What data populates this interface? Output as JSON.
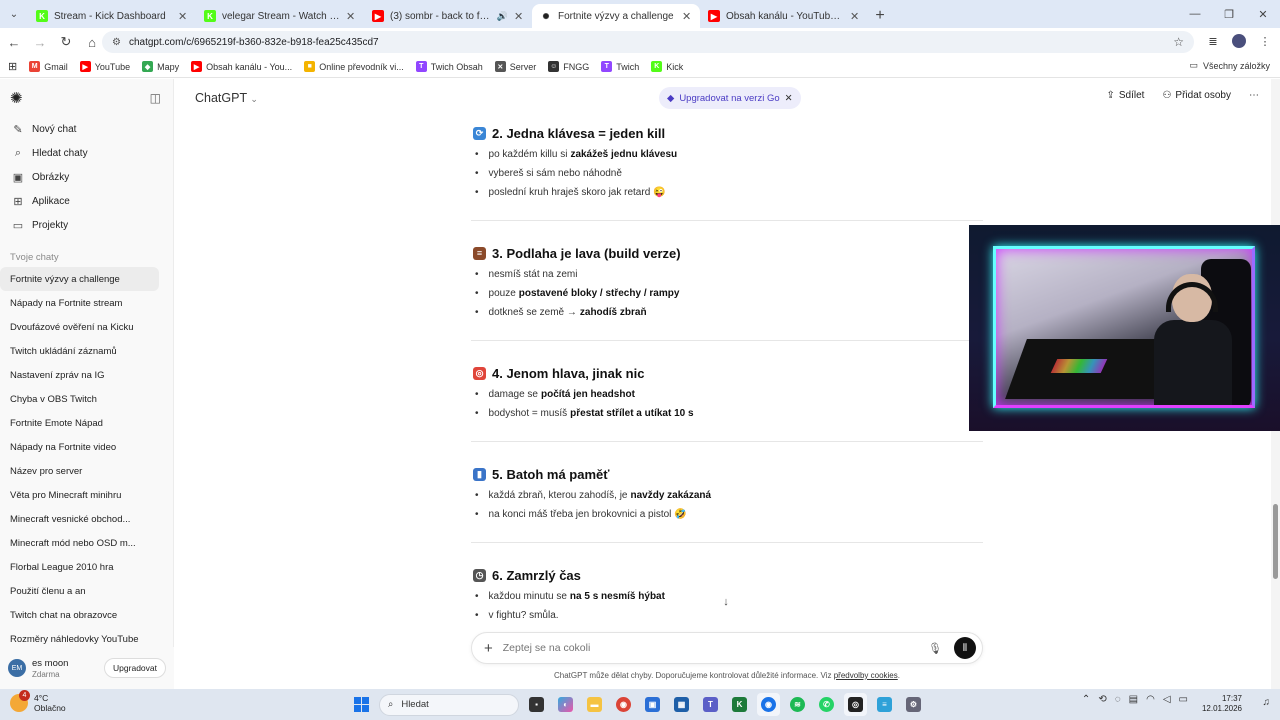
{
  "browser": {
    "tabs": [
      {
        "title": "Stream - Kick Dashboard",
        "favicon": "kick",
        "color": "#53fc18",
        "active": false
      },
      {
        "title": "velegar Stream - Watch Live on",
        "favicon": "kick",
        "color": "#53fc18",
        "active": false
      },
      {
        "title": "(3) sombr - back to friends",
        "favicon": "youtube",
        "color": "#ff0000",
        "active": false,
        "audio": true
      },
      {
        "title": "Fortnite výzvy a challenge",
        "favicon": "chatgpt",
        "color": "#222222",
        "active": true
      },
      {
        "title": "Obsah kanálu - YouTube Studio",
        "favicon": "youtube",
        "color": "#ff0000",
        "active": false
      }
    ],
    "url": "chatgpt.com/c/6965219f-b360-832e-b918-fea25c435cd7",
    "bookmarks": [
      {
        "label": "Gmail",
        "color": "#ea4335",
        "glyph": "M"
      },
      {
        "label": "YouTube",
        "color": "#ff0000",
        "glyph": "▶"
      },
      {
        "label": "Mapy",
        "color": "#34a853",
        "glyph": "◆"
      },
      {
        "label": "Obsah kanálu - You...",
        "color": "#ff0000",
        "glyph": "▶"
      },
      {
        "label": "Online převodník vi...",
        "color": "#f4b400",
        "glyph": "■"
      },
      {
        "label": "Twich Obsah",
        "color": "#9146ff",
        "glyph": "T"
      },
      {
        "label": "Server",
        "color": "#555555",
        "glyph": "✕"
      },
      {
        "label": "FNGG",
        "color": "#333333",
        "glyph": "☺"
      },
      {
        "label": "Twich",
        "color": "#9146ff",
        "glyph": "T"
      },
      {
        "label": "Kick",
        "color": "#53fc18",
        "glyph": "K"
      }
    ],
    "all_bookmarks": "Všechny záložky"
  },
  "sidebar": {
    "nav": [
      {
        "label": "Nový chat",
        "icon": "edit-icon",
        "glyph": "✎"
      },
      {
        "label": "Hledat chaty",
        "icon": "search-icon",
        "glyph": "⌕"
      },
      {
        "label": "Obrázky",
        "icon": "image-icon",
        "glyph": "▣"
      },
      {
        "label": "Aplikace",
        "icon": "apps-icon",
        "glyph": "⊞"
      },
      {
        "label": "Projekty",
        "icon": "folder-icon",
        "glyph": "▭"
      }
    ],
    "section_label": "Tvoje chaty",
    "chats": [
      "Fortnite výzvy a challenge",
      "Nápady na Fortnite stream",
      "Dvoufázové ověření na Kicku",
      "Twitch ukládání záznamů",
      "Nastavení zpráv na IG",
      "Chyba v OBS Twitch",
      "Fortnite Emote Nápad",
      "Nápady na Fortnite video",
      "Název pro server",
      "Věta pro Minecraft minihru",
      "Minecraft vesnické obchod...",
      "Minecraft mód nebo OSD m...",
      "Florbal League 2010 hra",
      "Použití členu a an",
      "Twitch chat na obrazovce",
      "Rozměry náhledovky YouTube"
    ],
    "user": {
      "initials": "EM",
      "name": "es moon",
      "plan": "Zdarma",
      "upgrade": "Upgradovat"
    }
  },
  "header": {
    "model": "ChatGPT",
    "upgrade_pill": "Upgradovat na verzi Go",
    "share": "Sdílet",
    "add_people": "Přidat osoby"
  },
  "sections": [
    {
      "title": "2. Jedna klávesa = jeden kill",
      "emoji_color": "#3a86d6",
      "emoji_glyph": "⟳",
      "items": [
        {
          "text": "po každém killu si",
          "bold": "zakážeš jednu klávesu"
        },
        {
          "text": "vybereš si sám nebo náhodně",
          "bold": ""
        },
        {
          "text": "poslední kruh hraješ skoro jak retard 😜",
          "bold": ""
        }
      ]
    },
    {
      "title": "3. Podlaha je lava (build verze)",
      "emoji_color": "#8b4a2a",
      "emoji_glyph": "≡",
      "items": [
        {
          "text": "nesmíš stát na zemi",
          "bold": ""
        },
        {
          "text": "pouze",
          "bold": "postavené bloky / střechy / rampy"
        },
        {
          "text": "dotkneš se země →",
          "bold": "zahodíš zbraň"
        }
      ]
    },
    {
      "title": "4. Jenom hlava, jinak nic",
      "emoji_color": "#e0453a",
      "emoji_glyph": "◎",
      "items": [
        {
          "text": "damage se",
          "bold": "počítá jen headshot"
        },
        {
          "text": "bodyshot = musíš",
          "bold": "přestat střílet a utíkat 10 s"
        }
      ]
    },
    {
      "title": "5. Batoh má paměť",
      "emoji_color": "#3a74c8",
      "emoji_glyph": "▮",
      "items": [
        {
          "text": "každá zbraň, kterou zahodíš, je",
          "bold": "navždy zakázaná"
        },
        {
          "text": "na konci máš třeba jen brokovnici a pistol 🤣",
          "bold": ""
        }
      ]
    },
    {
      "title": "6. Zamrzlý čas",
      "emoji_color": "#555555",
      "emoji_glyph": "◷",
      "items": [
        {
          "text": "každou minutu se",
          "bold": "na 5 s nesmíš hýbat"
        },
        {
          "text": "v fightu? smůla.",
          "bold": ""
        }
      ]
    }
  ],
  "composer": {
    "placeholder": "Zeptej se na cokoli"
  },
  "disclaimer": {
    "text": "ChatGPT může dělat chyby. Doporučujeme kontrolovat důležité informace. Viz",
    "link": "předvolby cookies",
    "end": "."
  },
  "taskbar": {
    "weather_temp": "4°C",
    "weather_desc": "Oblačno",
    "weather_badge": "4",
    "search_label": "Hledat",
    "time": "17:37",
    "date": "12.01.2026"
  }
}
